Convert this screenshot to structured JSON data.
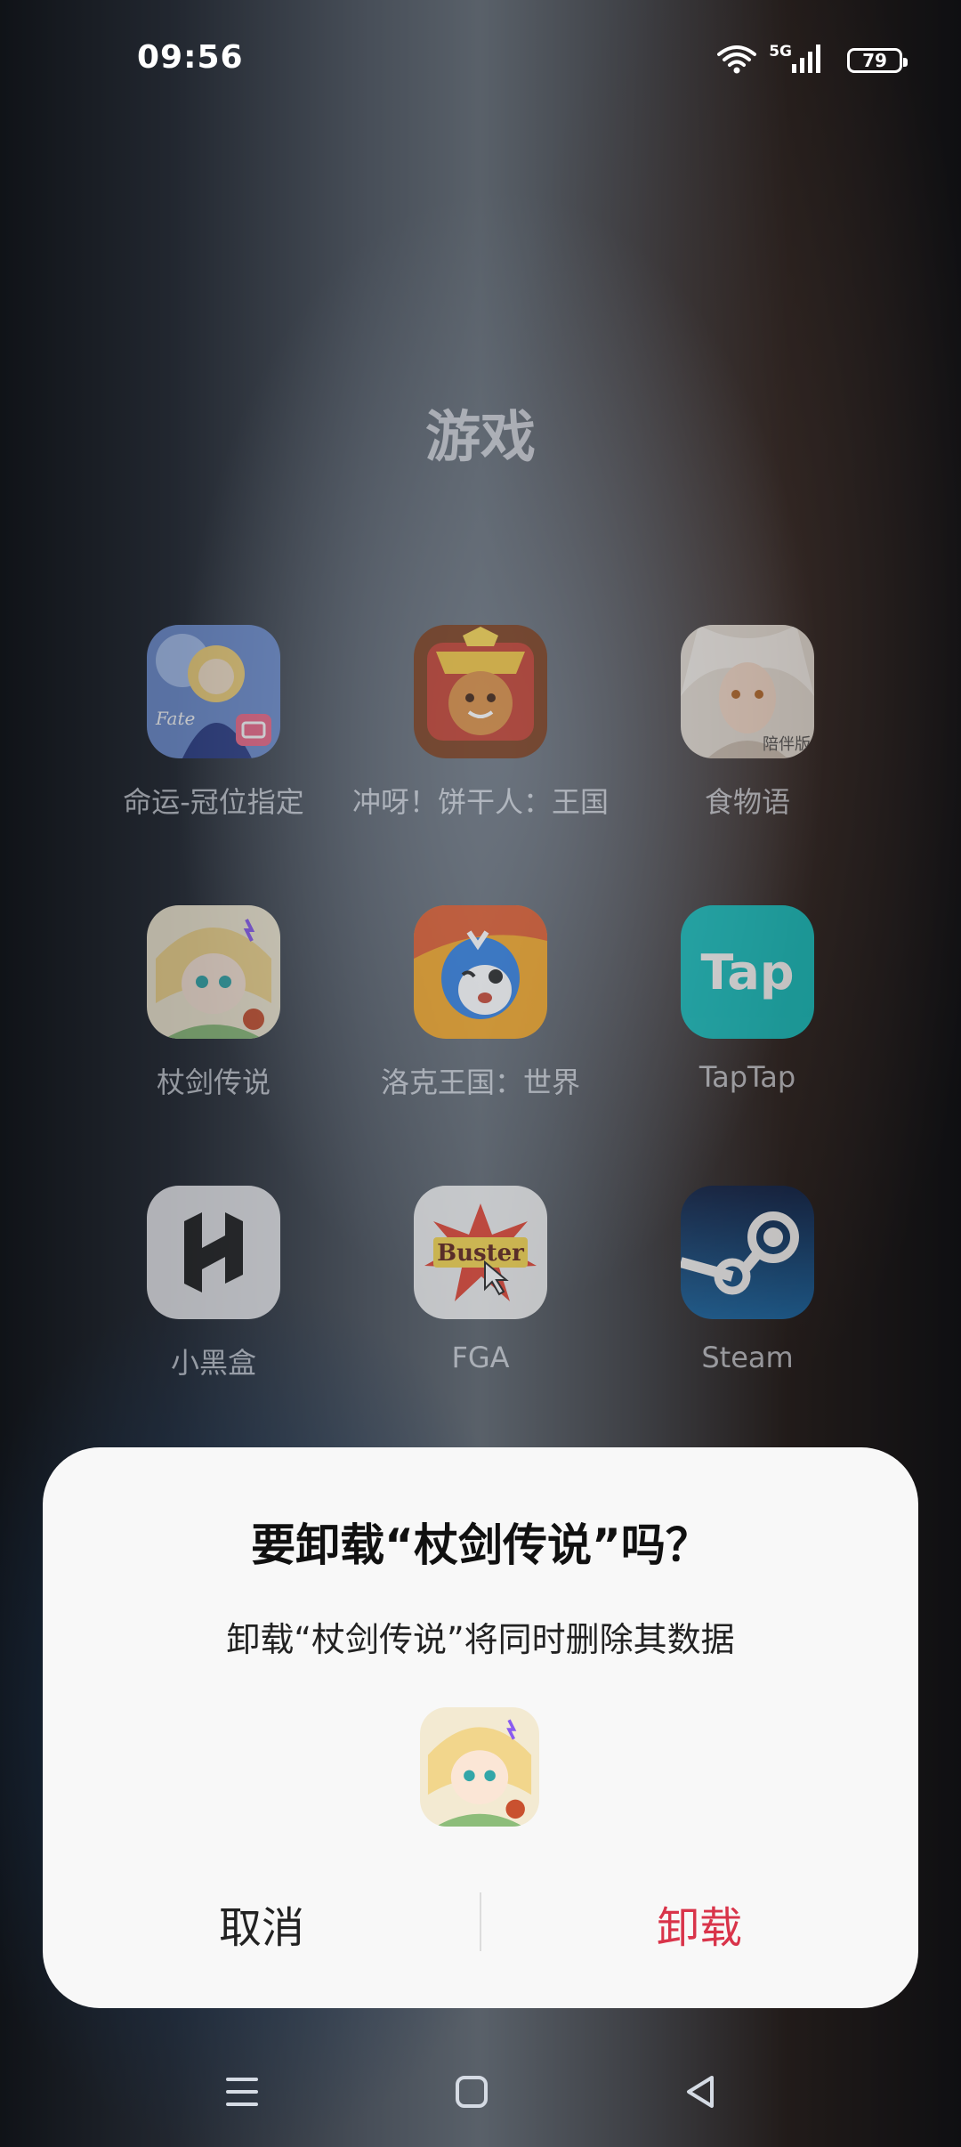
{
  "status_bar": {
    "time": "09:56",
    "network": "5G",
    "battery": "79"
  },
  "folder": {
    "title": "游戏",
    "apps": [
      {
        "label": "命运-冠位指定",
        "icon": "fate-grand-order-icon"
      },
      {
        "label": "冲呀！饼干人：王国",
        "icon": "cookie-run-kingdom-icon"
      },
      {
        "label": "食物语",
        "icon": "food-fantasy-icon"
      },
      {
        "label": "杖剑传说",
        "icon": "zhangjian-legend-icon"
      },
      {
        "label": "洛克王国：世界",
        "icon": "roco-kingdom-icon"
      },
      {
        "label": "TapTap",
        "icon": "taptap-icon"
      },
      {
        "label": "小黑盒",
        "icon": "xiaoheihe-icon"
      },
      {
        "label": "FGA",
        "icon": "fga-icon"
      },
      {
        "label": "Steam",
        "icon": "steam-icon"
      }
    ]
  },
  "dialog": {
    "title": "要卸载“杖剑传说”吗？",
    "message": "卸载“杖剑传说”将同时删除其数据",
    "cancel_label": "取消",
    "uninstall_label": "卸载",
    "uninstall_color": "#d9344a"
  },
  "nav_bar": {
    "menu": "menu-icon",
    "home": "home-icon",
    "back": "back-icon"
  }
}
